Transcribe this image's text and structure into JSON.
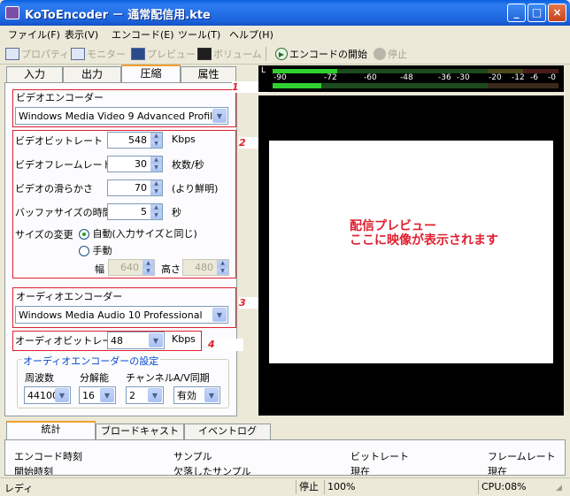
{
  "window": {
    "title": "KoToEncoder － 通常配信用.kte"
  },
  "menu": [
    "ファイル(F)",
    "表示(V)",
    "エンコード(E)",
    "ツール(T)",
    "ヘルプ(H)"
  ],
  "toolbar": {
    "property": "プロパティ",
    "monitor": "モニター",
    "preview": "プレビュー",
    "volume": "ボリューム",
    "start": "エンコードの開始",
    "stop": "停止"
  },
  "tabs": [
    "入力",
    "出力",
    "圧縮",
    "属性"
  ],
  "video_encoder": {
    "label": "ビデオエンコーダー",
    "value": "Windows Media Video 9 Advanced Profile",
    "marker": "1"
  },
  "video_settings": {
    "marker": "2",
    "bitrate": {
      "label": "ビデオビットレート",
      "value": "548",
      "unit": "Kbps"
    },
    "framerate": {
      "label": "ビデオフレームレート",
      "value": "30",
      "unit": "枚数/秒"
    },
    "smoothness": {
      "label": "ビデオの滑らかさ",
      "value": "70",
      "unit": "(より鮮明)"
    },
    "buffer": {
      "label": "バッファサイズの時間",
      "value": "5",
      "unit": "秒"
    },
    "size_change": {
      "label": "サイズの変更",
      "auto": "自動(入力サイズと同じ)",
      "manual": "手動",
      "width_label": "幅",
      "width": "640",
      "height_label": "高さ",
      "height": "480"
    }
  },
  "audio_encoder": {
    "label": "オーディオエンコーダー",
    "value": "Windows Media Audio 10 Professional",
    "marker": "3"
  },
  "audio_bitrate": {
    "label": "オーディオビットレート",
    "value": "48",
    "unit": "Kbps",
    "marker": "4"
  },
  "audio_settings": {
    "title": "オーディオエンコーダーの設定",
    "headers": [
      "周波数",
      "分解能",
      "チャンネル",
      "A/V同期"
    ],
    "values": [
      "44100",
      "16",
      "2",
      "有効"
    ]
  },
  "meter": {
    "channel": "L",
    "scale": [
      "-90",
      "-72",
      "-60",
      "-48",
      "-36",
      "-30",
      "-20",
      "-12",
      "-6",
      "-0"
    ]
  },
  "preview": {
    "line1": "配信プレビュー",
    "line2": "ここに映像が表示されます"
  },
  "bottom_tabs": [
    "統計",
    "ブロードキャスト",
    "イベントログ"
  ],
  "stats": {
    "row1": [
      "エンコード時刻",
      "サンプル",
      "ビットレート",
      "フレームレート"
    ],
    "row2": [
      "開始時刻",
      "欠落したサンプル",
      "現在",
      "現在"
    ]
  },
  "status": {
    "left": "レディ",
    "state": "停止",
    "zoom": "100%",
    "cpu": "CPU:08%"
  },
  "colors": {
    "marker": "#e02030",
    "accent": "#316ac5"
  }
}
